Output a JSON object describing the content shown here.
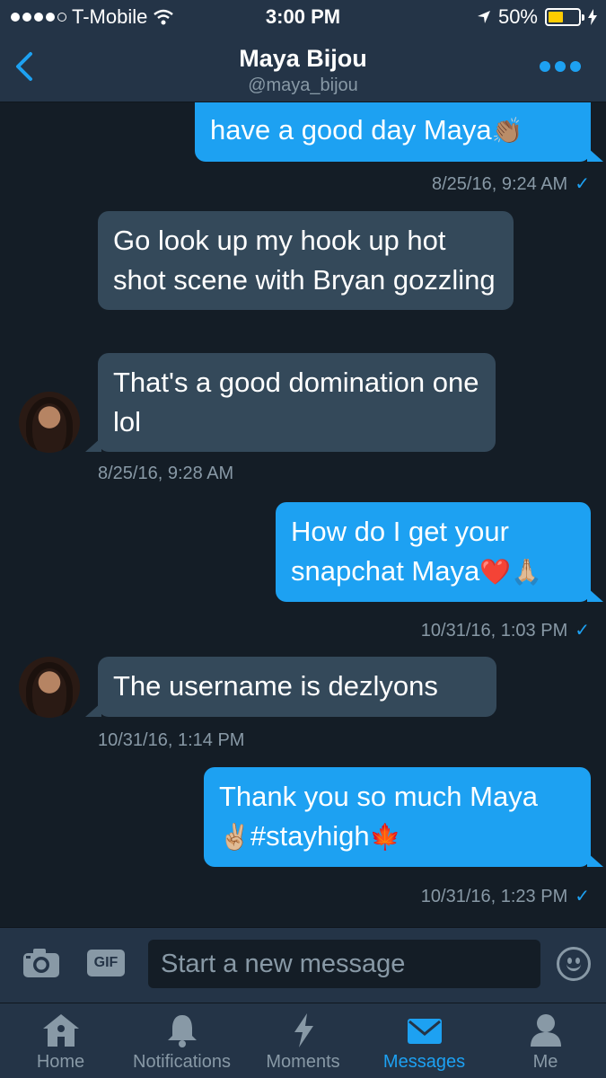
{
  "status": {
    "carrier": "T-Mobile",
    "time": "3:00 PM",
    "battery": "50%",
    "battery_level": 0.5
  },
  "header": {
    "name": "Maya Bijou",
    "handle": "@maya_bijou"
  },
  "messages": [
    {
      "text": "have a good day Maya",
      "emoji": "👏🏽",
      "direction": "out"
    },
    {
      "time": "8/25/16, 9:24 AM",
      "read": "✓"
    },
    {
      "text": "Go look up my hook up hot shot scene with Bryan gozzling",
      "direction": "in"
    },
    {
      "text": "That's a good domination one lol",
      "direction": "in"
    },
    {
      "time": "8/25/16, 9:28 AM"
    },
    {
      "text": "How do I get your snapchat Maya",
      "emoji": "❤️🙏🏼",
      "direction": "out"
    },
    {
      "time": "10/31/16, 1:03 PM",
      "read": "✓"
    },
    {
      "text": "The username is dezlyons",
      "direction": "in"
    },
    {
      "time": "10/31/16, 1:14 PM"
    },
    {
      "text": "Thank you so much Maya",
      "text2": "#stayhigh",
      "emoji_before": "✌🏼",
      "emoji": "🍁",
      "direction": "out"
    },
    {
      "time": "10/31/16, 1:23 PM",
      "read": "✓"
    }
  ],
  "composer": {
    "gif_label": "GIF",
    "placeholder": "Start a new message"
  },
  "tabs": [
    {
      "label": "Home",
      "icon": "home-icon"
    },
    {
      "label": "Notifications",
      "icon": "bell-icon"
    },
    {
      "label": "Moments",
      "icon": "lightning-icon"
    },
    {
      "label": "Messages",
      "icon": "envelope-icon",
      "active": true
    },
    {
      "label": "Me",
      "icon": "person-icon"
    }
  ],
  "colors": {
    "background": "#141d26",
    "bar": "#243447",
    "accent": "#1da1f2",
    "incoming_bubble": "#34495a",
    "muted": "#8899a6",
    "battery": "#ffcc00"
  }
}
